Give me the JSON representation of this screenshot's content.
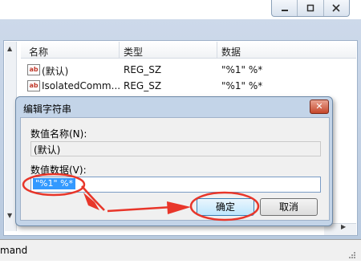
{
  "window_controls": {
    "minimize_icon": "minimize-icon",
    "restore_icon": "restore-icon",
    "close_icon": "close-icon"
  },
  "list": {
    "columns": [
      "名称",
      "类型",
      "数据"
    ],
    "rows": [
      {
        "name": "(默认)",
        "type": "REG_SZ",
        "data": "\"%1\" %*"
      },
      {
        "name": "IsolatedComm...",
        "type": "REG_SZ",
        "data": "\"%1\" %*"
      }
    ]
  },
  "status_bar": {
    "text": "mand"
  },
  "dialog": {
    "title": "编辑字符串",
    "name_label": "数值名称(N):",
    "name_value": "(默认)",
    "data_label": "数值数据(V):",
    "data_value": "\"%1\" %*",
    "ok_label": "确定",
    "cancel_label": "取消"
  },
  "annotation_color": "#e8362a"
}
